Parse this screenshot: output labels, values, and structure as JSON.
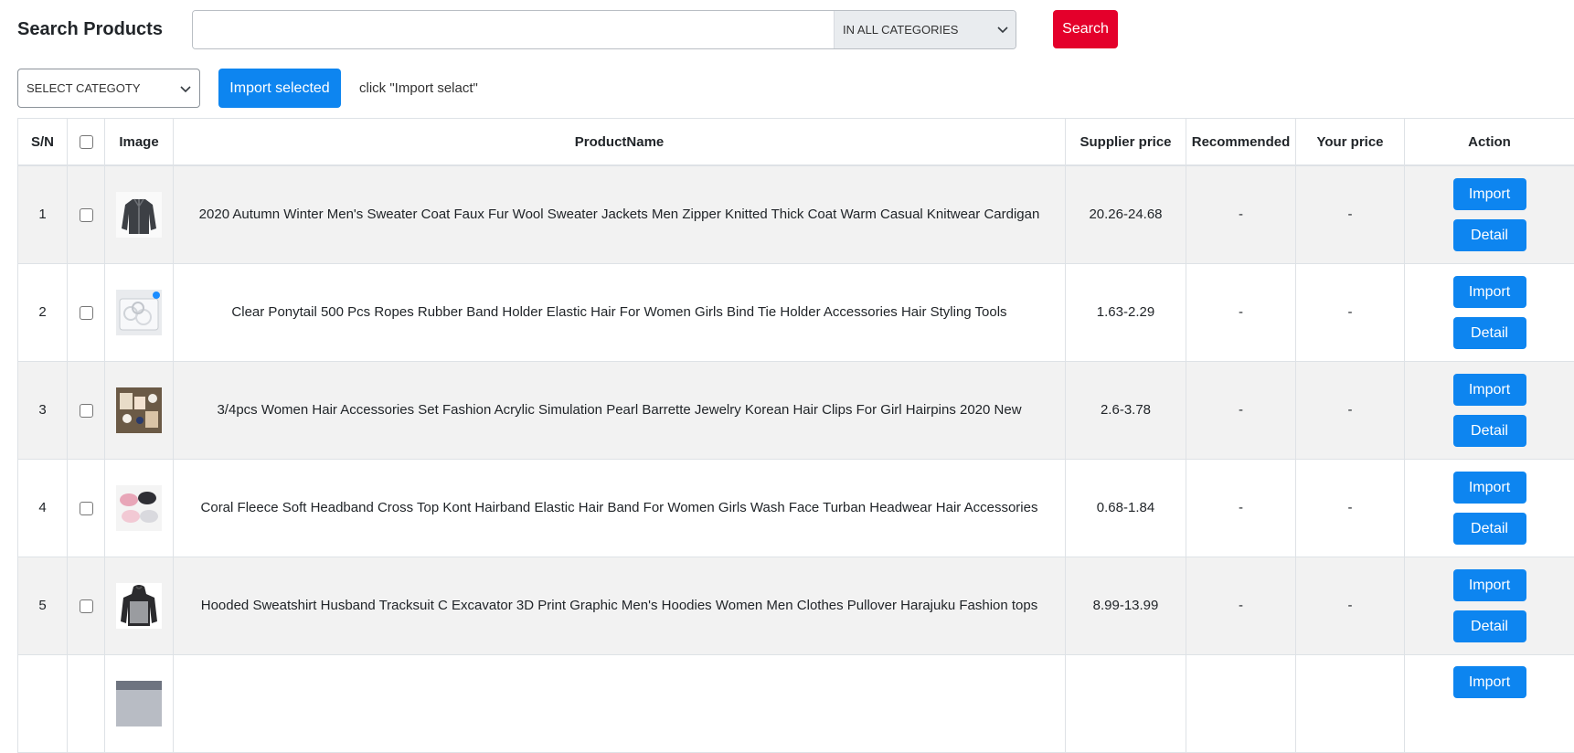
{
  "header": {
    "title": "Search Products",
    "search_value": "",
    "category_select": "IN ALL CATEGORIES",
    "search_button": "Search"
  },
  "toolbar": {
    "category_select": "SELECT CATEGOTY",
    "import_selected": "Import selected",
    "hint": "click \"Import selact\""
  },
  "table": {
    "columns": [
      "S/N",
      "",
      "Image",
      "ProductName",
      "Supplier price",
      "Recommended",
      "Your price",
      "Action"
    ],
    "action_labels": {
      "import": "Import",
      "detail": "Detail"
    },
    "rows": [
      {
        "sn": "1",
        "name": "2020 Autumn Winter Men's Sweater Coat Faux Fur Wool Sweater Jackets Men Zipper Knitted Thick Coat Warm Casual Knitwear Cardigan",
        "supplier_price": "20.26-24.68",
        "recommended": "-",
        "your_price": "-",
        "image_icon": "sweater-product-thumbnail"
      },
      {
        "sn": "2",
        "name": "Clear Ponytail 500 Pcs Ropes Rubber Band Holder Elastic Hair For Women Girls Bind Tie Holder Accessories Hair Styling Tools",
        "supplier_price": "1.63-2.29",
        "recommended": "-",
        "your_price": "-",
        "image_icon": "rubber-band-product-thumbnail"
      },
      {
        "sn": "3",
        "name": "3/4pcs Women Hair Accessories Set Fashion Acrylic Simulation Pearl Barrette Jewelry Korean Hair Clips For Girl Hairpins 2020 New",
        "supplier_price": "2.6-3.78",
        "recommended": "-",
        "your_price": "-",
        "image_icon": "hair-clips-product-thumbnail"
      },
      {
        "sn": "4",
        "name": "Coral Fleece Soft Headband Cross Top Kont Hairband Elastic Hair Band For Women Girls Wash Face Turban Headwear Hair Accessories",
        "supplier_price": "0.68-1.84",
        "recommended": "-",
        "your_price": "-",
        "image_icon": "headband-product-thumbnail"
      },
      {
        "sn": "5",
        "name": "Hooded Sweatshirt Husband Tracksuit C Excavator 3D Print Graphic Men's Hoodies Women Men Clothes Pullover Harajuku Fashion tops",
        "supplier_price": "8.99-13.99",
        "recommended": "-",
        "your_price": "-",
        "image_icon": "hoodie-product-thumbnail"
      },
      {
        "sn": "",
        "name": "",
        "supplier_price": "",
        "recommended": "",
        "your_price": "",
        "image_icon": "product-thumbnail"
      }
    ]
  },
  "colors": {
    "primary": "#0d85f0",
    "danger": "#e4002b",
    "row_stripe": "#f2f2f2",
    "border": "#dee2e6"
  }
}
